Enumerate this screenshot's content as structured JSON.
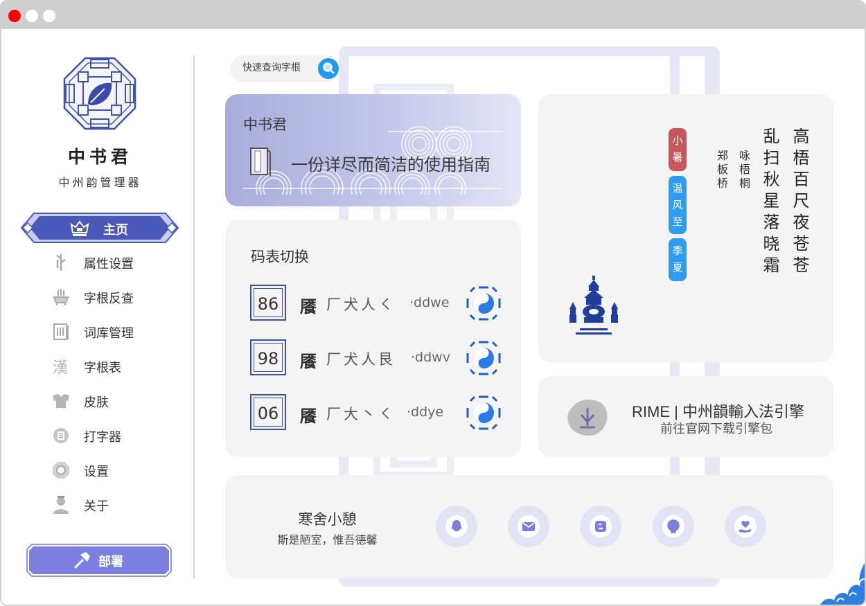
{
  "window": {
    "controls": [
      "close",
      "minimize",
      "maximize"
    ]
  },
  "sidebar": {
    "app_name": "中书君",
    "app_subtitle": "中州韵管理器",
    "home": {
      "label": "主页",
      "icon": "crown-icon"
    },
    "items": [
      {
        "label": "属性设置",
        "icon": "bamboo-icon"
      },
      {
        "label": "字根反查",
        "icon": "incense-burner-icon"
      },
      {
        "label": "词库管理",
        "icon": "scroll-icon"
      },
      {
        "label": "字根表",
        "icon": "han-character-icon"
      },
      {
        "label": "皮肤",
        "icon": "robe-icon"
      },
      {
        "label": "打字器",
        "icon": "typewriter-icon"
      },
      {
        "label": "设置",
        "icon": "settings-icon"
      },
      {
        "label": "关于",
        "icon": "person-icon"
      }
    ],
    "deploy": {
      "label": "部署",
      "icon": "hammer-icon"
    }
  },
  "search": {
    "placeholder": "快速查询字根"
  },
  "hero": {
    "title": "中书君",
    "subtitle": "一份详尽而简洁的使用指南"
  },
  "schema": {
    "title": "码表切换",
    "rows": [
      {
        "num": "86",
        "glyph": "餍",
        "roots": "厂犬人㇛",
        "code": "·ddwe"
      },
      {
        "num": "98",
        "glyph": "餍",
        "roots": "厂犬人艮",
        "code": "·ddwv"
      },
      {
        "num": "06",
        "glyph": "餍",
        "roots": "厂大丶㇛",
        "code": "·ddye"
      }
    ]
  },
  "poem": {
    "col1": "高梧百尺夜苍苍",
    "col2": "乱扫秋星落晓霜",
    "title": "咏梧桐",
    "author": "郑板桥",
    "seals": [
      "小暑",
      "温风至",
      "季夏"
    ]
  },
  "rime": {
    "title": "RIME | 中州韻輸入法引擎",
    "subtitle": "前往官网下载引擎包"
  },
  "footer": {
    "title": "寒舍小憩",
    "subtitle": "斯是陋室，惟吾德馨",
    "links": [
      "qq-icon",
      "mail-icon",
      "blogger-icon",
      "github-icon",
      "heart-hand-icon"
    ]
  },
  "colors": {
    "accent": "#4a58b8",
    "accent_light": "#7b7fdf",
    "search_button": "#1e9bf0",
    "seal_red": "#c9565c",
    "seal_blue": "#2f9cf3"
  }
}
